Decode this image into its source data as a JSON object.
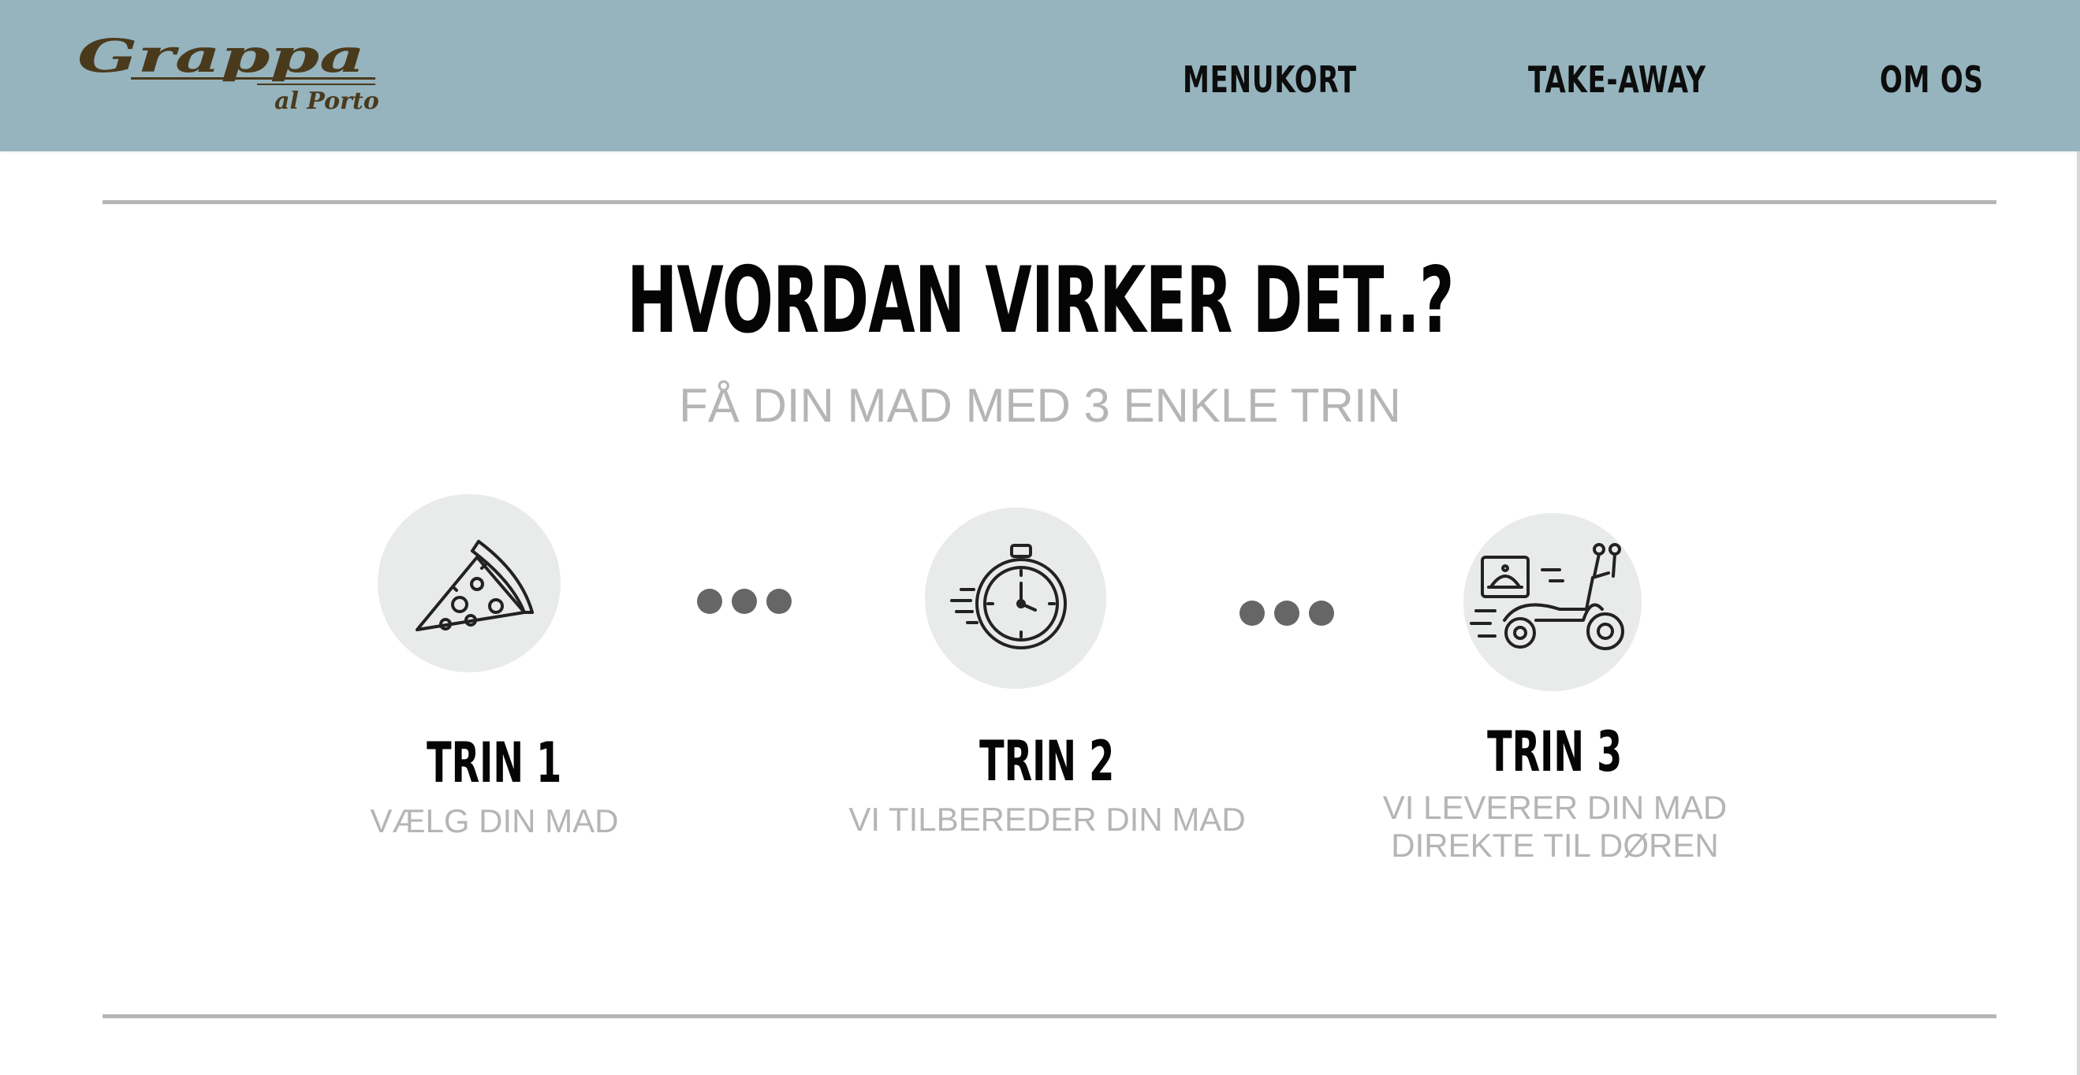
{
  "brand": {
    "logo_text": "Grappa",
    "logo_subtext": "al Porto",
    "logo_color": "#4a3a1c",
    "header_color": "#96b4be"
  },
  "nav": {
    "items": [
      {
        "label": "MENUKORT"
      },
      {
        "label": "TAKE-AWAY"
      },
      {
        "label": "OM OS"
      }
    ]
  },
  "section": {
    "heading": "HVORDAN VIRKER DET..?",
    "subheading": "FÅ DIN MAD MED 3 ENKLE TRIN"
  },
  "steps": [
    {
      "title": "TRIN 1",
      "description": "VÆLG DIN MAD",
      "icon": "pizza-slice-icon"
    },
    {
      "title": "TRIN 2",
      "description": "VI TILBEREDER DIN MAD",
      "icon": "stopwatch-icon"
    },
    {
      "title": "TRIN 3",
      "description_line1": "VI LEVERER DIN MAD",
      "description_line2": "DIREKTE TIL DØREN",
      "icon": "delivery-scooter-icon"
    }
  ],
  "colors": {
    "divider": "#b5b5b5",
    "subtext": "#b5b5b5",
    "icon_circle": "#e9eaea",
    "dot": "#666666"
  }
}
